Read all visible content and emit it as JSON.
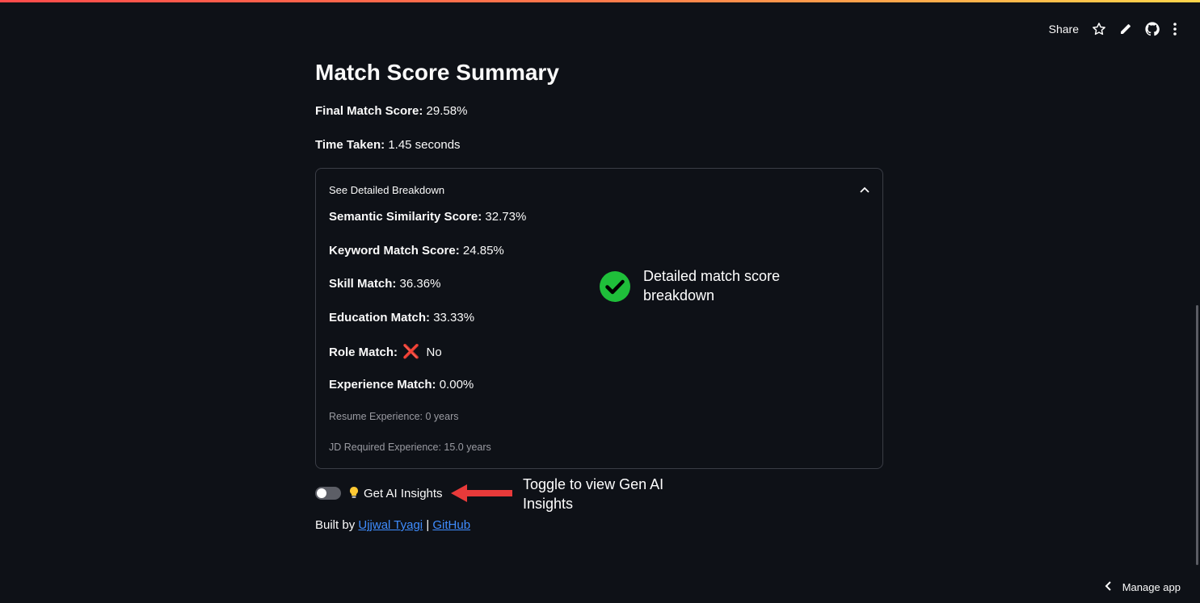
{
  "toolbar": {
    "share_label": "Share",
    "icons": [
      "star-icon",
      "pencil-icon",
      "github-icon",
      "more-vertical-icon"
    ]
  },
  "page": {
    "title": "Match Score Summary",
    "final_score_label": "Final Match Score:",
    "final_score_value": "29.58%",
    "time_label": "Time Taken:",
    "time_value": "1.45 seconds"
  },
  "expander": {
    "title": "See Detailed Breakdown",
    "semantic_label": "Semantic Similarity Score:",
    "semantic_value": "32.73%",
    "keyword_label": "Keyword Match Score:",
    "keyword_value": "24.85%",
    "skill_label": "Skill Match:",
    "skill_value": "36.36%",
    "education_label": "Education Match:",
    "education_value": "33.33%",
    "role_label": "Role Match:",
    "role_icon": "❌",
    "role_value": "No",
    "experience_label": "Experience Match:",
    "experience_value": "0.00%",
    "resume_experience": "Resume Experience: 0 years",
    "jd_experience": "JD Required Experience: 15.0 years"
  },
  "annotations": {
    "breakdown_note": "Detailed match score breakdown",
    "toggle_note": "Toggle to view Gen AI Insights"
  },
  "toggle": {
    "label": "Get AI Insights",
    "checked": false,
    "icon": "lightbulb-icon"
  },
  "footer": {
    "built_by": "Built by",
    "author_link": "Ujjwal Tyagi",
    "separator": "|",
    "github_link": "GitHub"
  },
  "manage_app": {
    "label": "Manage app"
  },
  "colors": {
    "background": "#0e1117",
    "text": "#fafafa",
    "link": "#3f8dff",
    "check_green": "#1fbf3a",
    "arrow_red": "#e83a3a",
    "cross_red": "#ef3d3d"
  }
}
